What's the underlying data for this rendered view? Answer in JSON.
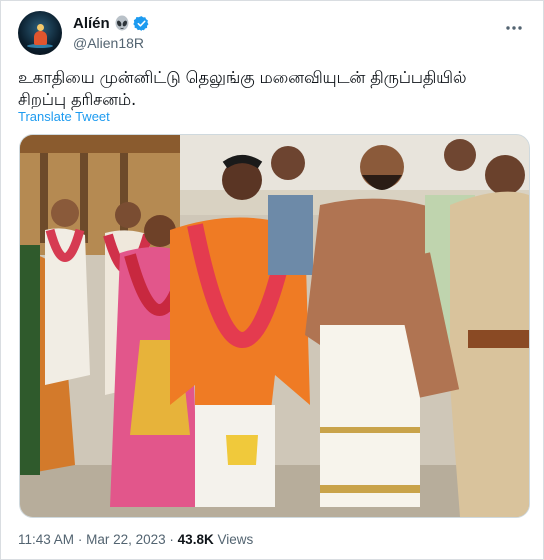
{
  "author": {
    "display_name": "Alíén",
    "handle": "@Alien18R",
    "emoji": "alien-emoji",
    "verified": true,
    "verified_color": "#1d9bf0"
  },
  "tweet": {
    "text_line1": "உகாதியை முன்னிட்டு தெலுங்கு மனைவியுடன் திருப்பதியில்",
    "text_line2": "சிறப்பு தரிசனம்.",
    "translate_label": "Translate Tweet",
    "media": {
      "kind": "photo",
      "content": "temple-visit-photo"
    }
  },
  "meta": {
    "time": "11:43 AM",
    "separator1": "·",
    "date": "Mar 22, 2023",
    "separator2": "·",
    "views_count": "43.8K",
    "views_label": "Views"
  },
  "icons": {
    "more": "more-horizontal-icon",
    "verified": "verified-badge-icon"
  },
  "colors": {
    "link": "#1d9bf0",
    "secondary_text": "#536471",
    "primary_text": "#0f1419"
  }
}
